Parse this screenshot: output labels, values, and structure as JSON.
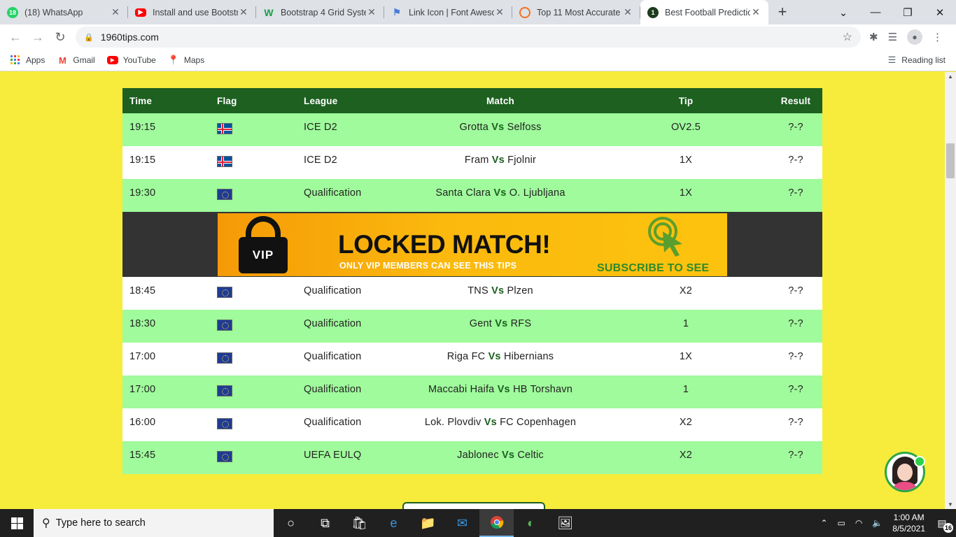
{
  "browser": {
    "tabs": [
      {
        "title": "(18) WhatsApp",
        "favicon": "whatsapp-icon",
        "badge": "18",
        "color": "#25d366"
      },
      {
        "title": "Install and use Bootstr",
        "favicon": "youtube-icon",
        "badge": "",
        "color": "#ff0000"
      },
      {
        "title": "Bootstrap 4 Grid Syste",
        "favicon": "w3-icon",
        "badge": "W",
        "color": "#1b9e4b"
      },
      {
        "title": "Link Icon | Font Aweso",
        "favicon": "flag-icon",
        "badge": "",
        "color": "#4a7bd8"
      },
      {
        "title": "Top 11 Most Accurate",
        "favicon": "circle-icon",
        "badge": "",
        "color": "#f37021"
      },
      {
        "title": "Best Football Predictio",
        "favicon": "site-icon",
        "badge": "1",
        "color": "#1d3b1d",
        "active": true
      }
    ],
    "url": "1960tips.com",
    "bookmarks": [
      {
        "label": "Apps",
        "icon": "apps-grid-icon"
      },
      {
        "label": "Gmail",
        "icon": "gmail-icon"
      },
      {
        "label": "YouTube",
        "icon": "youtube-icon"
      },
      {
        "label": "Maps",
        "icon": "maps-icon"
      }
    ],
    "reading_list": "Reading list"
  },
  "table": {
    "headers": {
      "time": "Time",
      "flag": "Flag",
      "league": "League",
      "match": "Match",
      "tip": "Tip",
      "result": "Result"
    },
    "rows_top": [
      {
        "time": "19:15",
        "flag": "iceland",
        "league": "ICE D2",
        "home": "Grotta",
        "vs": "Vs",
        "away": "Selfoss",
        "tip": "OV2.5",
        "result": "?-?"
      },
      {
        "time": "19:15",
        "flag": "iceland",
        "league": "ICE D2",
        "home": "Fram",
        "vs": "Vs",
        "away": "Fjolnir",
        "tip": "1X",
        "result": "?-?"
      },
      {
        "time": "19:30",
        "flag": "europe",
        "league": "Qualification",
        "home": "Santa Clara",
        "vs": "Vs",
        "away": "O. Ljubljana",
        "tip": "1X",
        "result": "?-?"
      }
    ],
    "banner": {
      "lock_label": "VIP",
      "title": "LOCKED MATCH!",
      "subtitle": "ONLY VIP MEMBERS CAN SEE THIS TIPS",
      "cta": "SUBSCRIBE TO SEE"
    },
    "rows_bottom": [
      {
        "time": "18:45",
        "flag": "europe",
        "league": "Qualification",
        "home": "TNS",
        "vs": "Vs",
        "away": "Plzen",
        "tip": "X2",
        "result": "?-?"
      },
      {
        "time": "18:30",
        "flag": "europe",
        "league": "Qualification",
        "home": "Gent",
        "vs": "Vs",
        "away": "RFS",
        "tip": "1",
        "result": "?-?"
      },
      {
        "time": "17:00",
        "flag": "europe",
        "league": "Qualification",
        "home": "Riga FC",
        "vs": "Vs",
        "away": "Hibernians",
        "tip": "1X",
        "result": "?-?"
      },
      {
        "time": "17:00",
        "flag": "europe",
        "league": "Qualification",
        "home": "Maccabi Haifa",
        "vs": "Vs",
        "away": "HB Torshavn",
        "tip": "1",
        "result": "?-?"
      },
      {
        "time": "16:00",
        "flag": "europe",
        "league": "Qualification",
        "home": "Lok. Plovdiv",
        "vs": "Vs",
        "away": "FC Copenhagen",
        "tip": "X2",
        "result": "?-?"
      },
      {
        "time": "15:45",
        "flag": "europe",
        "league": "UEFA EULQ",
        "home": "Jablonec",
        "vs": "Vs",
        "away": "Celtic",
        "tip": "X2",
        "result": "?-?"
      }
    ]
  },
  "taskbar": {
    "search_placeholder": "Type here to search",
    "time": "1:00 AM",
    "date": "8/5/2021",
    "notifications": "16"
  },
  "colors": {
    "page_bg": "#f7ec3b",
    "header_bg": "#1d6020",
    "row_green": "#9ffb9b",
    "accent_vs": "#1d6020"
  }
}
